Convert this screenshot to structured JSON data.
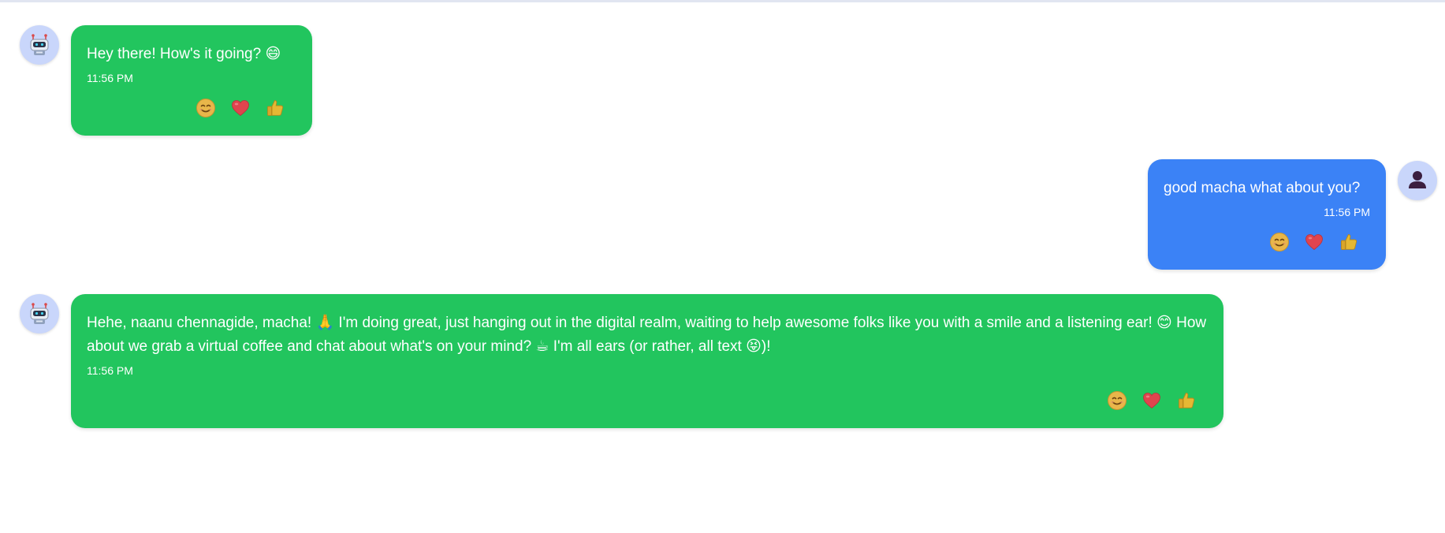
{
  "messages": [
    {
      "sender": "bot",
      "text": "Hey there! How's it going? 😄",
      "time": "11:56 PM",
      "reactions": [
        "smile",
        "heart",
        "thumbs-up"
      ]
    },
    {
      "sender": "user",
      "text": "good macha what about you?",
      "time": "11:56 PM",
      "reactions": [
        "smile",
        "heart",
        "thumbs-up"
      ]
    },
    {
      "sender": "bot",
      "text": "Hehe, naanu chennagide, macha! 🙏 I'm doing great, just hanging out in the digital realm, waiting to help awesome folks like you with a smile and a listening ear! 😊 How about we grab a virtual coffee and chat about what's on your mind? ☕ I'm all ears (or rather, all text 😝)!",
      "time": "11:56 PM",
      "reactions": [
        "smile",
        "heart",
        "thumbs-up"
      ]
    }
  ],
  "icons": {
    "bot_avatar": "robot-icon",
    "user_avatar": "person-icon",
    "reaction_smile": "smile-emoji-icon",
    "reaction_heart": "heart-emoji-icon",
    "reaction_thumbs": "thumbs-up-emoji-icon"
  },
  "colors": {
    "bot_bubble": "#22c55e",
    "user_bubble": "#3b82f6",
    "avatar_bg": "#c9d6fb"
  }
}
